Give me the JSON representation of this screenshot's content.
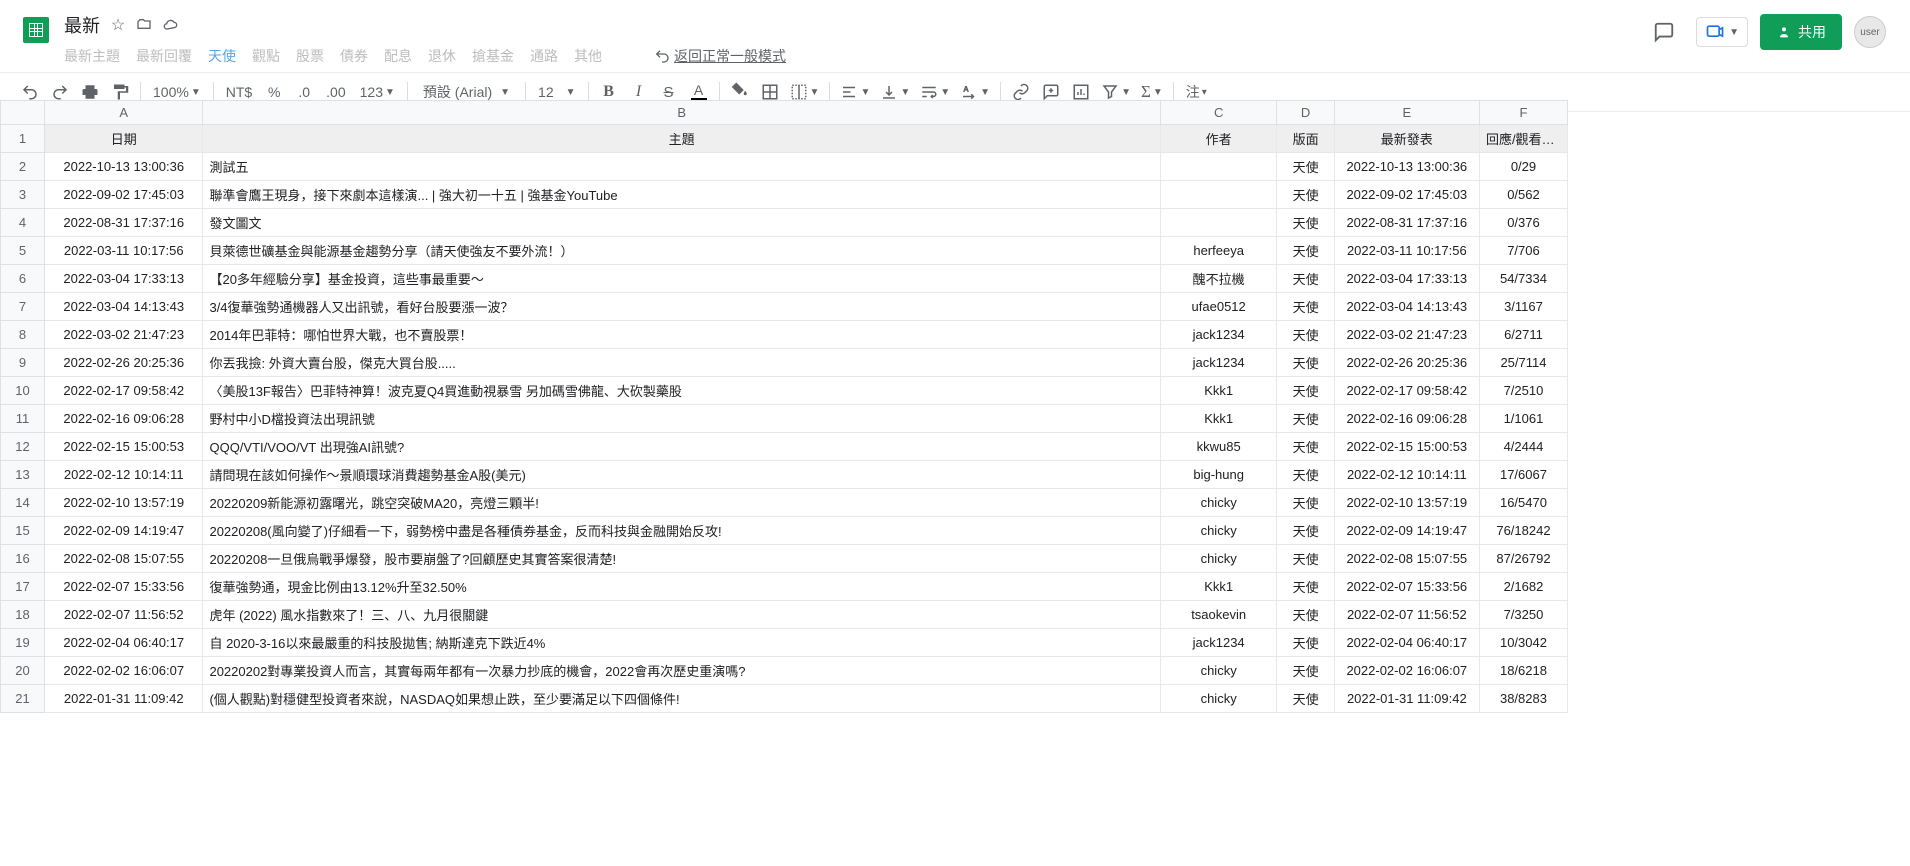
{
  "doc": {
    "title": "最新"
  },
  "menubar": {
    "items": [
      "最新主題",
      "最新回覆",
      "天使",
      "觀點",
      "股票",
      "債券",
      "配息",
      "退休",
      "搶基金",
      "通路",
      "其他"
    ],
    "activeIndex": 2,
    "returnLabel": "返回正常一般模式"
  },
  "toolbar": {
    "zoom": "100%",
    "currency": "NT$",
    "percent": "%",
    "inc_dec_l": ".0",
    "inc_dec_r": ".00",
    "numfmt": "123",
    "font": "預設 (Arial)",
    "fontSize": "12",
    "note": "注"
  },
  "headerRight": {
    "share": "共用",
    "avatarAlt": "user"
  },
  "columns": [
    "A",
    "B",
    "C",
    "D",
    "E",
    "F"
  ],
  "headerRow": {
    "A": "日期",
    "B": "主題",
    "C": "作者",
    "D": "版面",
    "E": "最新發表",
    "F": "回應/觀看次數"
  },
  "rows": [
    {
      "A": "2022-10-13 13:00:36",
      "B": "測試五",
      "C": "",
      "D": "天使",
      "E": "2022-10-13 13:00:36",
      "F": "0/29"
    },
    {
      "A": "2022-09-02 17:45:03",
      "B": "聯準會鷹王現身，接下來劇本這樣演... | 強大初一十五 | 強基金YouTube",
      "C": "",
      "D": "天使",
      "E": "2022-09-02 17:45:03",
      "F": "0/562"
    },
    {
      "A": "2022-08-31 17:37:16",
      "B": "發文圖文",
      "C": "",
      "D": "天使",
      "E": "2022-08-31 17:37:16",
      "F": "0/376"
    },
    {
      "A": "2022-03-11 10:17:56",
      "B": "貝萊德世礦基金與能源基金趨勢分享（請天使強友不要外流！）",
      "C": "herfeeya",
      "D": "天使",
      "E": "2022-03-11 10:17:56",
      "F": "7/706"
    },
    {
      "A": "2022-03-04 17:33:13",
      "B": "【20多年經驗分享】基金投資，這些事最重要～",
      "C": "醜不拉機",
      "D": "天使",
      "E": "2022-03-04 17:33:13",
      "F": "54/7334"
    },
    {
      "A": "2022-03-04 14:13:43",
      "B": "3/4復華強勢通機器人又出訊號，看好台股要漲一波？",
      "C": "ufae0512",
      "D": "天使",
      "E": "2022-03-04 14:13:43",
      "F": "3/1167"
    },
    {
      "A": "2022-03-02 21:47:23",
      "B": "2014年巴菲特：哪怕世界大戰，也不賣股票！",
      "C": "jack1234",
      "D": "天使",
      "E": "2022-03-02 21:47:23",
      "F": "6/2711"
    },
    {
      "A": "2022-02-26 20:25:36",
      "B": "你丟我撿: 外資大賣台股，傑克大買台股.....",
      "C": "jack1234",
      "D": "天使",
      "E": "2022-02-26 20:25:36",
      "F": "25/7114"
    },
    {
      "A": "2022-02-17 09:58:42",
      "B": "〈美股13F報告〉巴菲特神算！波克夏Q4買進動視暴雪 另加碼雪佛龍、大砍製藥股",
      "C": "Kkk1",
      "D": "天使",
      "E": "2022-02-17 09:58:42",
      "F": "7/2510"
    },
    {
      "A": "2022-02-16 09:06:28",
      "B": "野村中小D檔投資法出現訊號",
      "C": "Kkk1",
      "D": "天使",
      "E": "2022-02-16 09:06:28",
      "F": "1/1061"
    },
    {
      "A": "2022-02-15 15:00:53",
      "B": "QQQ/VTI/VOO/VT 出現強AI訊號?",
      "C": "kkwu85",
      "D": "天使",
      "E": "2022-02-15 15:00:53",
      "F": "4/2444"
    },
    {
      "A": "2022-02-12 10:14:11",
      "B": "請問現在該如何操作～景順環球消費趨勢基金A股(美元)",
      "C": "big-hung",
      "D": "天使",
      "E": "2022-02-12 10:14:11",
      "F": "17/6067"
    },
    {
      "A": "2022-02-10 13:57:19",
      "B": "20220209新能源初露曙光，跳空突破MA20，亮燈三顆半!",
      "C": "chicky",
      "D": "天使",
      "E": "2022-02-10 13:57:19",
      "F": "16/5470"
    },
    {
      "A": "2022-02-09 14:19:47",
      "B": "20220208(風向變了)仔細看一下，弱勢榜中盡是各種債券基金，反而科技與金融開始反攻!",
      "C": "chicky",
      "D": "天使",
      "E": "2022-02-09 14:19:47",
      "F": "76/18242"
    },
    {
      "A": "2022-02-08 15:07:55",
      "B": "20220208一旦俄烏戰爭爆發，股市要崩盤了?回顧歷史其實答案很清楚!",
      "C": "chicky",
      "D": "天使",
      "E": "2022-02-08 15:07:55",
      "F": "87/26792"
    },
    {
      "A": "2022-02-07 15:33:56",
      "B": "復華強勢通，現金比例由13.12%升至32.50%",
      "C": "Kkk1",
      "D": "天使",
      "E": "2022-02-07 15:33:56",
      "F": "2/1682"
    },
    {
      "A": "2022-02-07 11:56:52",
      "B": "虎年 (2022) 風水指數來了！三、八、九月很關鍵",
      "C": "tsaokevin",
      "D": "天使",
      "E": "2022-02-07 11:56:52",
      "F": "7/3250"
    },
    {
      "A": "2022-02-04 06:40:17",
      "B": "自 2020-3-16以來最嚴重的科技股拋售; 納斯達克下跌近4%",
      "C": "jack1234",
      "D": "天使",
      "E": "2022-02-04 06:40:17",
      "F": "10/3042"
    },
    {
      "A": "2022-02-02 16:06:07",
      "B": "20220202對專業投資人而言，其實每兩年都有一次暴力抄底的機會，2022會再次歷史重演嗎?",
      "C": "chicky",
      "D": "天使",
      "E": "2022-02-02 16:06:07",
      "F": "18/6218"
    },
    {
      "A": "2022-01-31 11:09:42",
      "B": "(個人觀點)對穩健型投資者來說，NASDAQ如果想止跌，至少要滿足以下四個條件!",
      "C": "chicky",
      "D": "天使",
      "E": "2022-01-31 11:09:42",
      "F": "38/8283"
    }
  ]
}
